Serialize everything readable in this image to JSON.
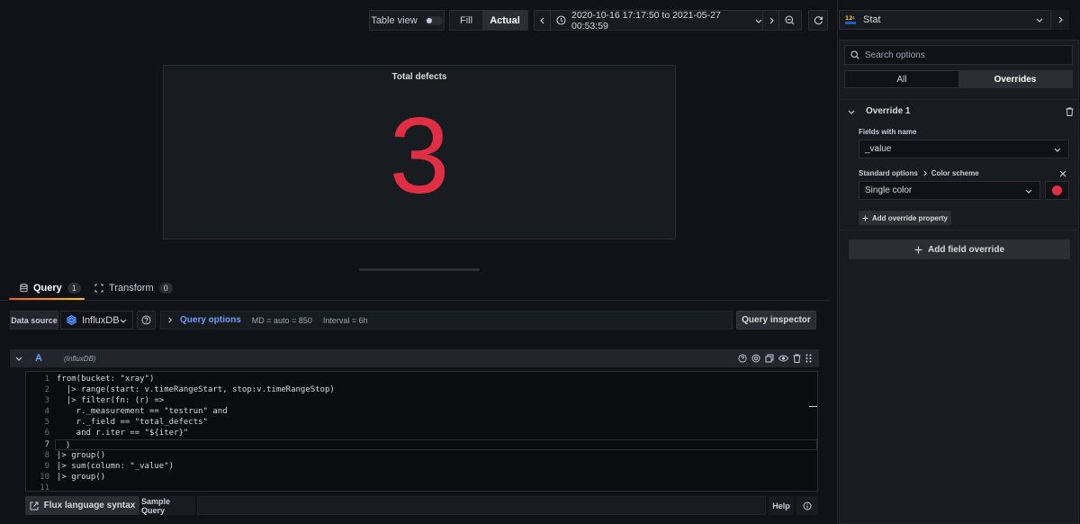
{
  "toolbar": {
    "table_view_label": "Table view",
    "fill_label": "Fill",
    "actual_label": "Actual",
    "time_range": "2020-10-16 17:17:50 to 2021-05-27 00:53:59"
  },
  "panel": {
    "title": "Total defects",
    "value": "3",
    "value_color": "#e02f44"
  },
  "tabs": [
    {
      "label": "Query",
      "count": "1"
    },
    {
      "label": "Transform",
      "count": "0"
    }
  ],
  "datasource": {
    "label": "Data source",
    "name": "InfluxDB",
    "query_options_label": "Query options",
    "md_info": "MD = auto = 850",
    "interval_info": "Interval = 6h",
    "query_inspector_label": "Query inspector"
  },
  "query": {
    "ref": "A",
    "datasource_name": "(InfluxDB)",
    "line_numbers": [
      "1",
      "2",
      "3",
      "4",
      "5",
      "6",
      "7",
      "8",
      "9",
      "10",
      "11"
    ],
    "lines": [
      "from(bucket: \"xray\")",
      "  |> range(start: v.timeRangeStart, stop:v.timeRangeStop)",
      "  |> filter(fn: (r) =>",
      "    r._measurement == \"testrun\" and",
      "    r._field == \"total_defects\"",
      "    and r.iter == \"${iter}\"",
      "  )",
      "|> group()",
      "|> sum(column: \"_value\")",
      "|> group()",
      ""
    ]
  },
  "editor_footer": {
    "flux_syntax_label": "Flux language syntax",
    "sample_query_label": "Sample Query",
    "help_label": "Help"
  },
  "options_pane": {
    "visualization": "Stat",
    "search_placeholder": "Search options",
    "segments": [
      "All",
      "Overrides"
    ],
    "override_title": "Override 1",
    "fields_with_name_label": "Fields with name",
    "fields_with_name_value": "_value",
    "property_path_1": "Standard options",
    "property_path_2": "Color scheme",
    "color_scheme_value": "Single color",
    "color_swatch": "#e02f44",
    "add_override_property_label": "Add override property",
    "add_field_override_label": "Add field override"
  },
  "colors": {
    "accent_blue": "#6e9fff",
    "tab_underline_start": "#f05a28",
    "tab_underline_end": "#fbca0a"
  }
}
